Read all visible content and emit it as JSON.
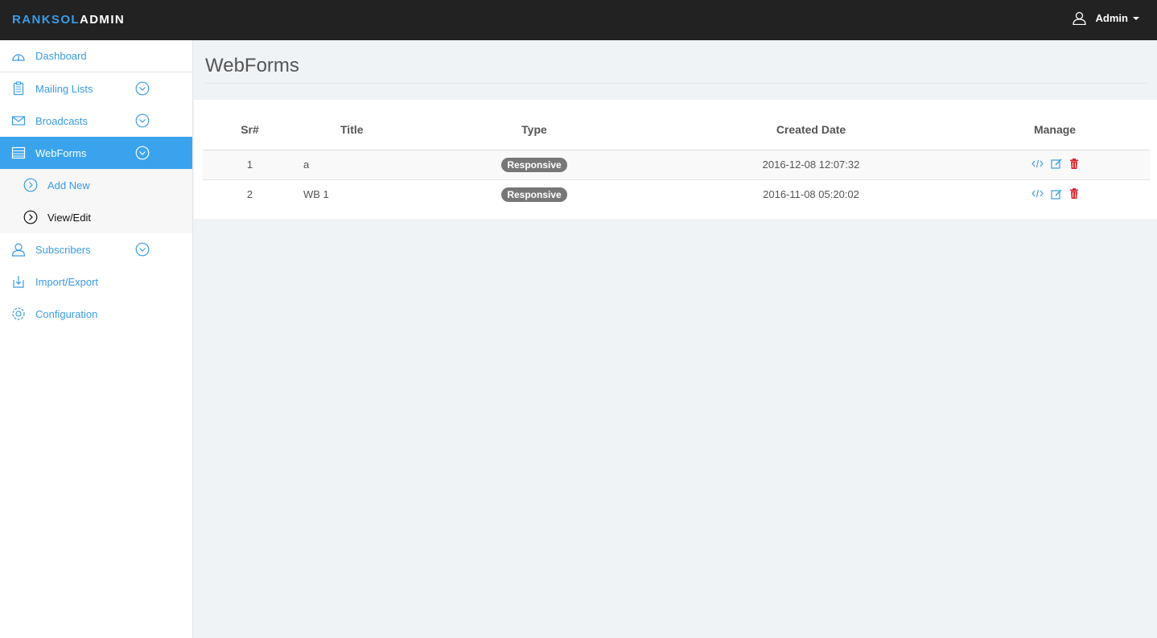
{
  "brand": {
    "part1": "RANKSOL",
    "part2": "ADMIN"
  },
  "user": {
    "name": "Admin"
  },
  "sidebar": {
    "items": [
      {
        "label": "Dashboard"
      },
      {
        "label": "Mailing Lists"
      },
      {
        "label": "Broadcasts"
      },
      {
        "label": "WebForms"
      },
      {
        "label": "Subscribers"
      },
      {
        "label": "Import/Export"
      },
      {
        "label": "Configuration"
      }
    ],
    "webforms_sub": [
      {
        "label": "Add New"
      },
      {
        "label": "View/Edit"
      }
    ]
  },
  "page": {
    "title": "WebForms"
  },
  "table": {
    "headers": {
      "sr": "Sr#",
      "title": "Title",
      "type": "Type",
      "date": "Created Date",
      "manage": "Manage"
    },
    "rows": [
      {
        "sr": "1",
        "title": "a",
        "type": "Responsive",
        "date": "2016-12-08 12:07:32"
      },
      {
        "sr": "2",
        "title": "WB 1",
        "type": "Responsive",
        "date": "2016-11-08 05:20:02"
      }
    ]
  },
  "colors": {
    "accent": "#3a9be8",
    "active": "#3aa3ee",
    "topbar": "#222222",
    "delete": "#d9232d",
    "badge": "#777777"
  }
}
